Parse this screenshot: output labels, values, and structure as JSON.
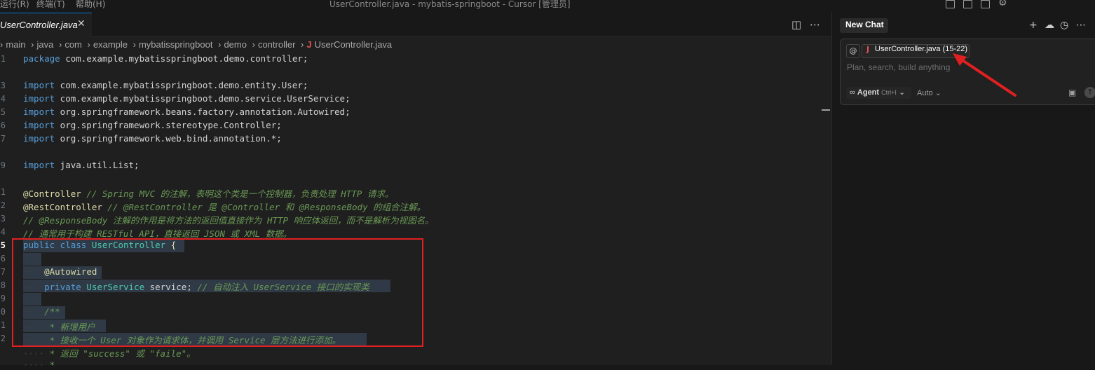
{
  "menubar": {
    "items": [
      "运行(R)",
      "终端(T)",
      "帮助(H)"
    ]
  },
  "window_title": "UserController.java - mybatis-springboot - Cursor [管理员]",
  "editor": {
    "tab_label": "UserController.java",
    "tab_close": "✕",
    "breadcrumb": [
      "main",
      "java",
      "com",
      "example",
      "mybatisspringboot",
      "demo",
      "controller"
    ],
    "breadcrumb_file": "UserController.java",
    "breadcrumb_file_icon": "J",
    "line_numbers": [
      "1",
      "",
      "3",
      "4",
      "5",
      "6",
      "7",
      "",
      "9",
      "",
      "1",
      "2",
      "3",
      "4",
      "5",
      "6",
      "7",
      "8",
      "9",
      "0",
      "1",
      "2"
    ],
    "line_numbers_bold": "5",
    "code": {
      "l1_kw": "package",
      "l1_rest": " com.example.mybatisspringboot.demo.controller;",
      "imp_kw": "import",
      "l3": " com.example.mybatisspringboot.demo.entity.User;",
      "l4": " com.example.mybatisspringboot.demo.service.UserService;",
      "l5": " org.springframework.beans.factory.annotation.Autowired;",
      "l6": " org.springframework.stereotype.Controller;",
      "l7": " org.springframework.web.bind.annotation.*;",
      "l9": " java.util.List;",
      "l11_ann": "@Controller",
      "l11_cmt": " // Spring MVC 的注解，表明这个类是一个控制器，负责处理 HTTP 请求。",
      "l12_ann": "@RestController",
      "l12_cmt": " // @RestController 是 @Controller 和 @ResponseBody 的组合注解。",
      "l13": "// @ResponseBody 注解的作用是将方法的返回值直接作为 HTTP 响应体返回，而不是解析为视图名。",
      "l14": "// 通常用于构建 RESTful API，直接返回 JSON 或 XML 数据。",
      "l15_kw": "public class",
      "l15_cls": " UserController",
      "l15_rest": " {",
      "l17": "@Autowired",
      "l18_kw": "private",
      "l18_cls": " UserService",
      "l18_rest": " service;",
      "l18_cmt": " // 自动注入 UserService 接口的实现类",
      "l20": "/**",
      "l21": " * 新增用户",
      "l22": " * 接收一个 User 对象作为请求体，并调用 Service 层方法进行添加。",
      "l23": " * 返回 \"success\" 或 \"faile\"。",
      "l24": " *"
    }
  },
  "chat": {
    "tab_label": "New Chat",
    "context_chip": "UserController.java (15-22)",
    "context_icon": "J",
    "at_symbol": "@",
    "placeholder": "Plan, search, build anything",
    "agent_label": "Agent",
    "agent_shortcut": "Ctrl+I",
    "model_label": "Auto"
  },
  "annotation_color": "#e02020"
}
